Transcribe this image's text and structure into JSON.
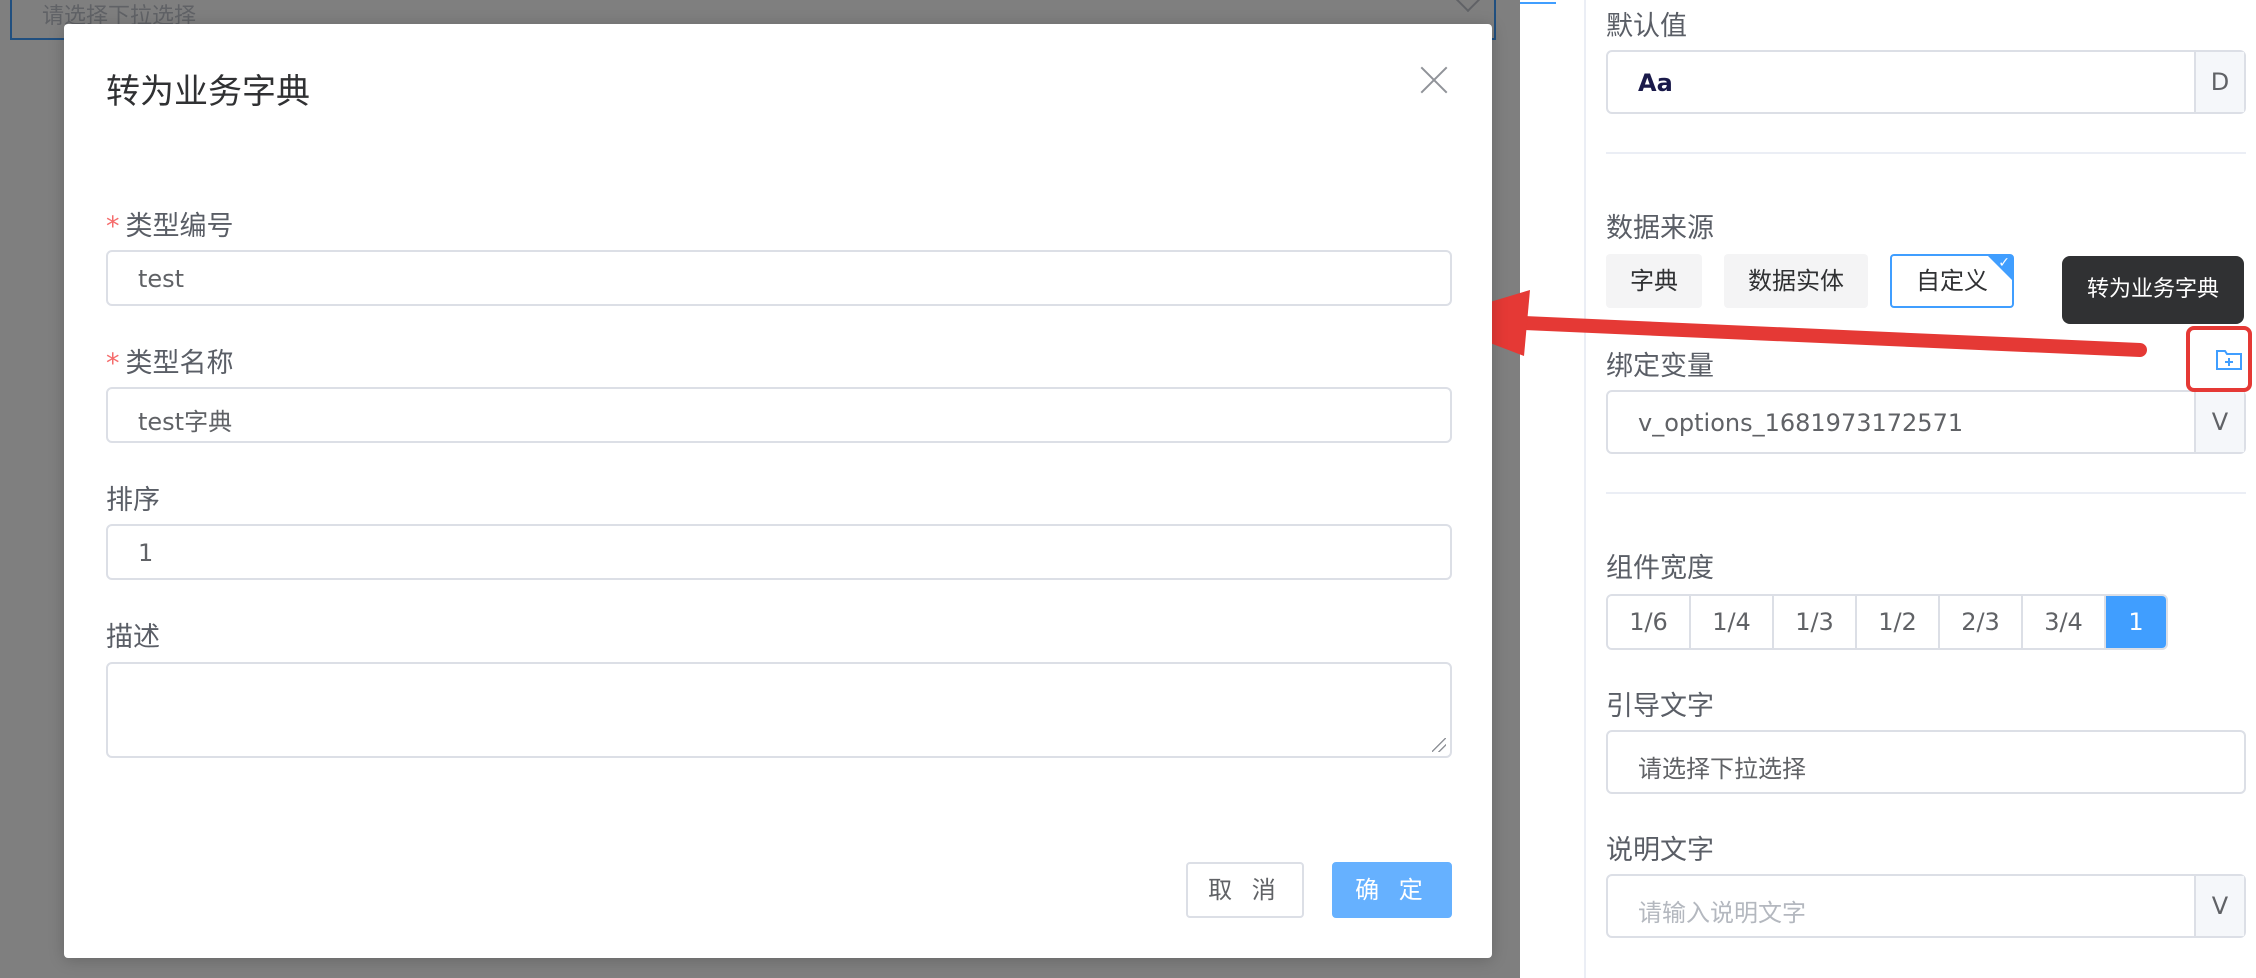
{
  "canvas": {
    "select_placeholder": "请选择下拉选择"
  },
  "modal": {
    "title": "转为业务字典",
    "fields": [
      {
        "label": "类型编号",
        "required": true,
        "value": "test"
      },
      {
        "label": "类型名称",
        "required": true,
        "value": "test字典"
      },
      {
        "label": "排序",
        "required": false,
        "value": "1"
      },
      {
        "label": "描述",
        "required": false,
        "value": ""
      }
    ],
    "required_mark": "*",
    "cancel_label": "取 消",
    "confirm_label": "确 定"
  },
  "panel": {
    "default_value": {
      "label": "默认值",
      "value": "Aa",
      "suffix": "D"
    },
    "data_source": {
      "label": "数据来源",
      "options": [
        "字典",
        "数据实体",
        "自定义"
      ],
      "selected": "自定义"
    },
    "bind_variable": {
      "label": "绑定变量",
      "value": "v_options_1681973172571",
      "suffix": "V"
    },
    "width": {
      "label": "组件宽度",
      "options": [
        "1/6",
        "1/4",
        "1/3",
        "1/2",
        "2/3",
        "3/4",
        "1"
      ],
      "selected": "1"
    },
    "guide_text": {
      "label": "引导文字",
      "value": "请选择下拉选择"
    },
    "desc_text": {
      "label": "说明文字",
      "placeholder": "请输入说明文字",
      "suffix": "V"
    },
    "tooltip": "转为业务字典"
  },
  "colors": {
    "primary": "#409eff",
    "annotation_red": "#e53935",
    "required": "#f56c6c"
  },
  "icons": {
    "convert": "folder-plus-icon",
    "close": "close-icon"
  }
}
